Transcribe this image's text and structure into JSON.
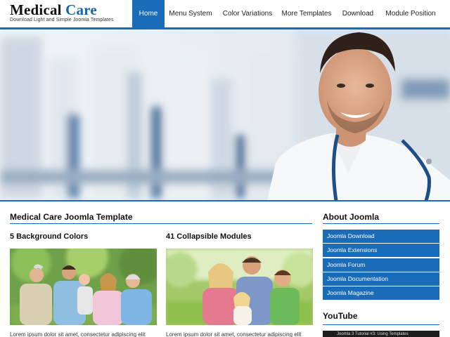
{
  "logo": {
    "title_dark": "Medical",
    "title_accent": "Care",
    "tagline": "Download Light and Simple Joomla Templates"
  },
  "nav": {
    "items": [
      {
        "label": "Home",
        "active": true
      },
      {
        "label": "Menu System"
      },
      {
        "label": "Color Variations"
      },
      {
        "label": "More Templates"
      },
      {
        "label": "Download"
      },
      {
        "label": "Module Position"
      }
    ]
  },
  "colors": {
    "accent": "#1a6bb8",
    "logo_accent": "#1565b0"
  },
  "main": {
    "title": "Medical Care Joomla Template",
    "columns": [
      {
        "heading": "5 Background Colors",
        "text": "Lorem ipsum dolor sit amet, consectetur adipiscing elit"
      },
      {
        "heading": "41 Collapsible Modules",
        "text": "Lorem ipsum dolor sit amet, consectetur adipiscing elit"
      }
    ]
  },
  "sidebar": {
    "title": "About Joomla",
    "links": [
      "Joomla Download",
      "Joomla Extensions",
      "Joomla Forum",
      "Joomla Documentation",
      "Joomla Magazine"
    ],
    "youtube_title": "YouTube",
    "video_title": "Joomla 3 Tutorial #3: Using Templates"
  }
}
